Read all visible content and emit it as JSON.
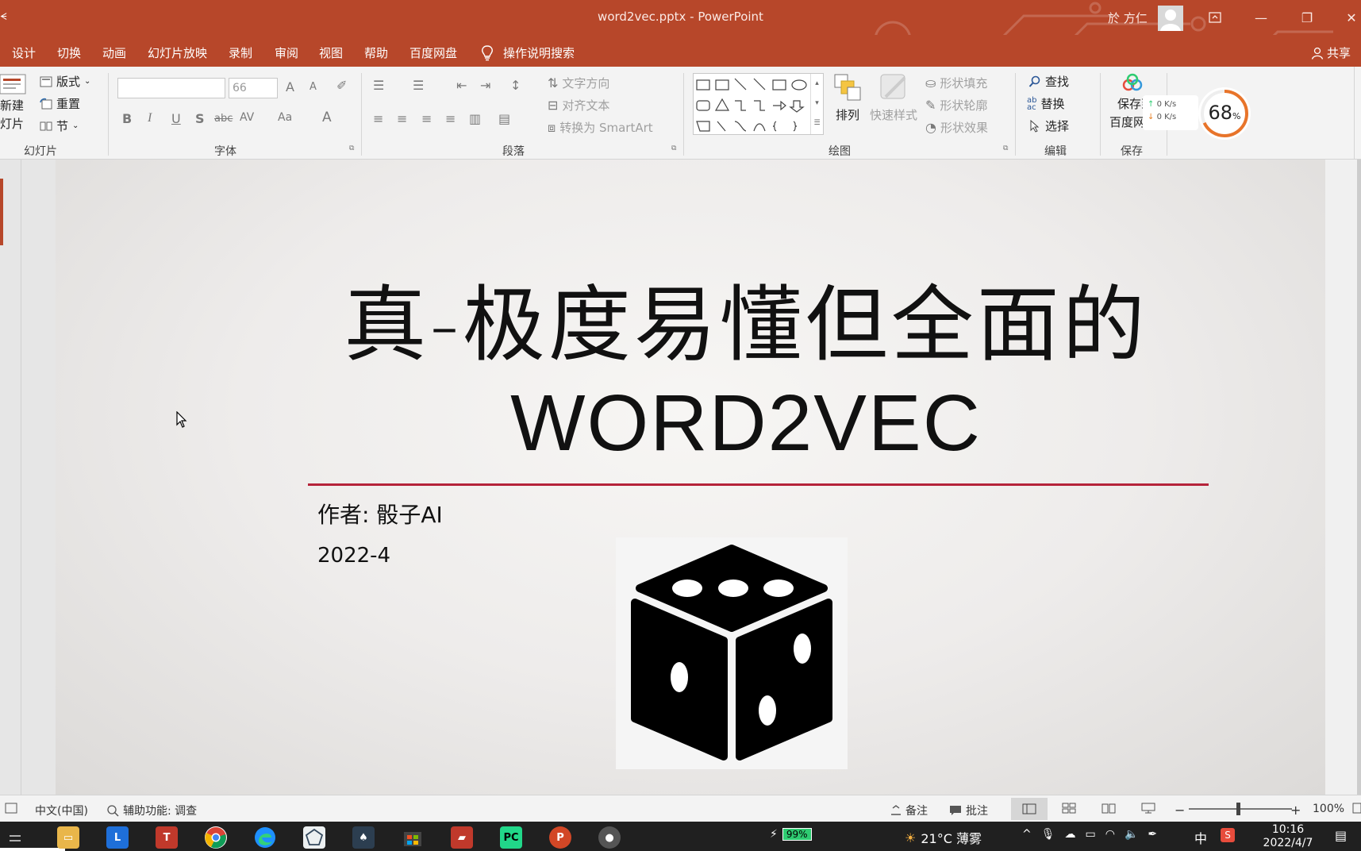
{
  "window": {
    "title": "word2vec.pptx  -  PowerPoint",
    "user": "於 方仁",
    "min": "—",
    "restore": "❐",
    "close": "✕"
  },
  "tabs": [
    "设计",
    "切换",
    "动画",
    "幻灯片放映",
    "录制",
    "审阅",
    "视图",
    "帮助",
    "百度网盘"
  ],
  "tell_me": "操作说明搜索",
  "share": "共享",
  "ribbon": {
    "slides": {
      "new": "新建",
      "new2": "灯片",
      "layout": "版式",
      "reset": "重置",
      "section": "节",
      "label": "幻灯片"
    },
    "font": {
      "name_value": "",
      "size_value": "66",
      "label": "字体",
      "bold": "B",
      "italic": "I",
      "underline": "U",
      "shadow": "S",
      "strike": "abc",
      "spacing": "AV",
      "case": "Aa",
      "color": "A",
      "grow": "A",
      "shrink": "A"
    },
    "paragraph": {
      "label": "段落",
      "text_dir": "文字方向",
      "align_text": "对齐文本",
      "smartart": "转换为 SmartArt"
    },
    "drawing": {
      "label": "绘图",
      "arrange": "排列",
      "quick_styles": "快速样式",
      "fill": "形状填充",
      "outline": "形状轮廓",
      "effects": "形状效果"
    },
    "editing": {
      "label": "编辑",
      "find": "查找",
      "replace": "替换",
      "select": "选择"
    },
    "save": {
      "label": "保存",
      "save_to": "保存到",
      "baidu": "百度网盘"
    },
    "net": {
      "up": "0  K/s",
      "down": "0  K/s",
      "gauge": "68",
      "gauge_unit": "%"
    }
  },
  "slide": {
    "title_line1": "真-极度易懂但全面的",
    "title_line2": "WORD2VEC",
    "author": "作者: 骰子AI",
    "year": "2022-4"
  },
  "status": {
    "language": "中文(中国)",
    "accessibility": "辅助功能: 调查",
    "notes": "备注",
    "comments": "批注",
    "zoom": "100%"
  },
  "taskbar": {
    "battery": "99%",
    "weather": "21°C  薄雾",
    "ime": "中",
    "time": "10:16",
    "date": "2022/4/7"
  }
}
